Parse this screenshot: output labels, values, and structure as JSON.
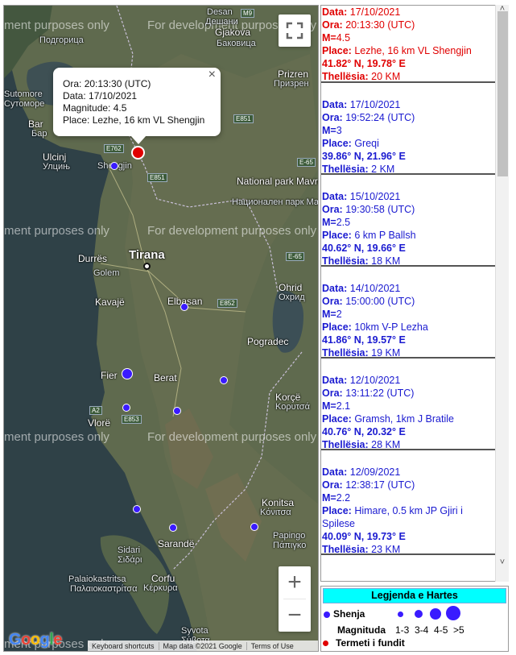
{
  "map": {
    "popup": {
      "ora_label": "Ora:",
      "ora": "20:13:30 (UTC)",
      "data_label": "Data:",
      "data": "17/10/2021",
      "mag_label": "Magnitude:",
      "mag": "4.5",
      "place_label": "Place:",
      "place": "Lezhe, 16 km VL Shengjin",
      "close": "×"
    },
    "watermark": "For development purposes only",
    "watermark_left": "ment purposes only",
    "places": {
      "desan": "Desan",
      "desan_cyr": "Дешани",
      "gjakova": "Gjakova",
      "gjakova_cyr": "Баковица",
      "prizren": "Prizren",
      "prizren_cyr": "Призрен",
      "podgorica": "Подгорица",
      "sutomore": "Sutomore",
      "sutomore_cyr": "Сутоморе",
      "bar": "Bar",
      "bar_cyr": "Бар",
      "ulcinj": "Ulcinj",
      "ulcinj_cyr": "Улцињ",
      "shengjin": "Shengjin",
      "mavrovo": "National park Mavrovo",
      "mavrovo_cyr": "Национален парк Маврово",
      "durres": "Durrës",
      "golem": "Golem",
      "tirana": "Tirana",
      "kavaje": "Kavajë",
      "elbasan": "Elbasan",
      "ohrid": "Ohrid",
      "ohrid_cyr": "Охрид",
      "pogradec": "Pogradec",
      "fier": "Fier",
      "berat": "Berat",
      "korce": "Korçë",
      "korce_gr": "Κορυτσά",
      "vlore": "Vlorë",
      "konitsa": "Konitsa",
      "konitsa_gr": "Κόνιτσα",
      "papingo": "Papingo",
      "papingo_gr": "Πάπιγκο",
      "sarande": "Sarandë",
      "sidari": "Sidari",
      "sidari_gr": "Σιδάρι",
      "palaiokastritsa": "Palaiokastritsa",
      "palaiokastritsa_gr": "Παλαιοκαστρίτσα",
      "corfu": "Corfu",
      "corfu_gr": "Κέρκυρα",
      "syvota": "Syvota",
      "syvota_gr": "Σύβοτα"
    },
    "roads": {
      "m9": "M9",
      "e851a": "E851",
      "e762": "E762",
      "e851b": "E851",
      "e65a": "E-65",
      "e65b": "E-65",
      "e852": "E852",
      "a2": "A2",
      "e853": "E853"
    },
    "zoom_in": "+",
    "zoom_out": "−",
    "google": [
      "G",
      "o",
      "o",
      "g",
      "l",
      "e"
    ],
    "attribution": [
      "Keyboard shortcuts",
      "Map data ©2021 Google",
      "Terms of Use"
    ],
    "colors": {
      "quake": "#3a1bff",
      "latest": "#e00000"
    }
  },
  "list_labels": {
    "data": "Data:",
    "ora": "Ora:",
    "m": "M=",
    "place": "Place:",
    "depth": "Thellësia:"
  },
  "entries": [
    {
      "date": "17/10/2021",
      "time": "20:13:30 (UTC)",
      "mag": "4.5",
      "place": "Lezhe, 16 km VL Shengjin",
      "coords": "41.82° N, 19.78° E",
      "depth": "20 KM"
    },
    {
      "date": "17/10/2021",
      "time": "19:52:24 (UTC)",
      "mag": "3",
      "place": "Greqi",
      "coords": "39.86° N, 21.96° E",
      "depth": "2 KM"
    },
    {
      "date": "15/10/2021",
      "time": "19:30:58 (UTC)",
      "mag": "2.5",
      "place": "6 km P Ballsh",
      "coords": "40.62° N, 19.66° E",
      "depth": "18 KM"
    },
    {
      "date": "14/10/2021",
      "time": "15:00:00 (UTC)",
      "mag": "2",
      "place": "10km V-P Lezha",
      "coords": "41.86° N, 19.57° E",
      "depth": "19 KM"
    },
    {
      "date": "12/10/2021",
      "time": "13:11:22 (UTC)",
      "mag": "2.1",
      "place": "Gramsh, 1km J Bratile",
      "coords": "40.76° N, 20.32° E",
      "depth": "28 KM"
    },
    {
      "date": "12/09/2021",
      "time": "12:38:17 (UTC)",
      "mag": "2.2",
      "place": "Himare, 0.5 km JP Gjiri i Spilese",
      "coords": "40.09° N, 19.73° E",
      "depth": "23 KM"
    }
  ],
  "legend": {
    "title": "Legjenda e Hartes",
    "shenja": "Shenja",
    "magnituda": "Magnituda",
    "ranges": "1-3  3-4  4-5  >5",
    "latest": "Termeti i fundit"
  },
  "scroll": {
    "up": "˄",
    "down": "˅"
  }
}
